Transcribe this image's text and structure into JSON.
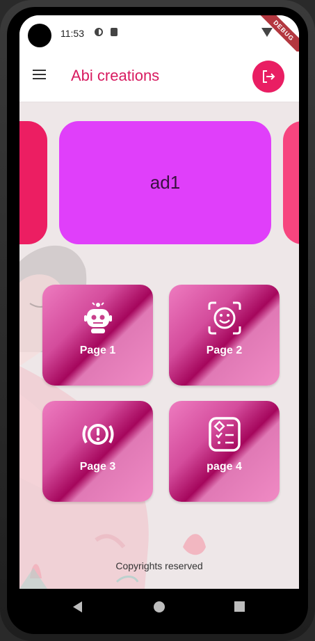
{
  "status_bar": {
    "time": "11:53",
    "debug_label": "DEBUG"
  },
  "app_bar": {
    "title": "Abi creations",
    "menu_icon": "menu-icon",
    "logout_icon": "logout-icon",
    "accent_color": "#e91e63",
    "title_color": "#d81b60"
  },
  "carousel": {
    "items": [
      {
        "label": "",
        "color": "#ec1e62"
      },
      {
        "label": "ad1",
        "color": "#e03ffa"
      },
      {
        "label": "",
        "color": "#f7457f"
      }
    ]
  },
  "tiles": [
    {
      "label": "Page 1",
      "icon": "robot-icon"
    },
    {
      "label": "Page 2",
      "icon": "face-scan-icon"
    },
    {
      "label": "Page 3",
      "icon": "alert-circle-icon"
    },
    {
      "label": "page 4",
      "icon": "checklist-icon"
    }
  ],
  "footer": {
    "copyright": "Copyrights reserved"
  },
  "nav_bar": {
    "back_icon": "back-icon",
    "home_icon": "home-icon",
    "recents_icon": "recents-icon"
  }
}
